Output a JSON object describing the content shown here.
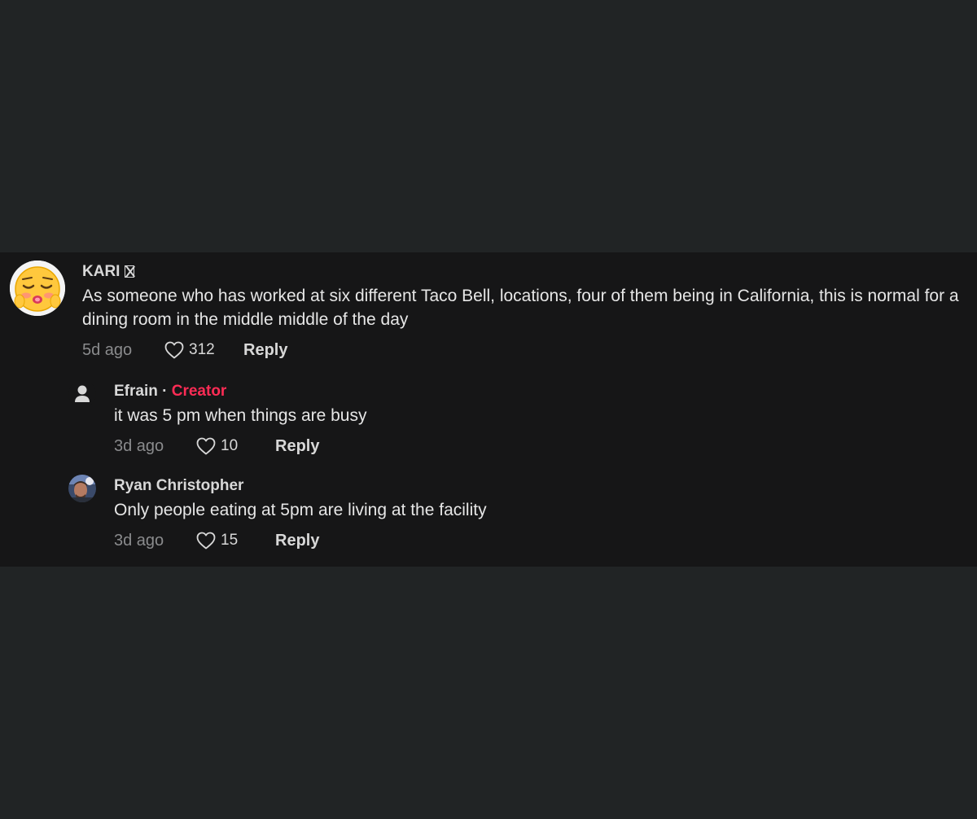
{
  "comments": [
    {
      "username": "KARI",
      "text": "As someone who has worked at six different Taco Bell, locations, four of them being in California, this is normal for a dining room in the middle middle of the day",
      "time": "5d ago",
      "likes": "312",
      "reply_label": "Reply"
    }
  ],
  "replies": [
    {
      "username": "Efrain",
      "separator": "·",
      "badge": "Creator",
      "text": "it was 5 pm when things are busy",
      "time": "3d ago",
      "likes": "10",
      "reply_label": "Reply"
    },
    {
      "username": "Ryan Christopher",
      "text": "Only people eating at 5pm are living at the facility",
      "time": "3d ago",
      "likes": "15",
      "reply_label": "Reply"
    }
  ],
  "colors": {
    "page_bg": "#212425",
    "panel_bg": "#161617",
    "creator_badge": "#fe2c55",
    "muted_text": "#8a8b8d"
  }
}
